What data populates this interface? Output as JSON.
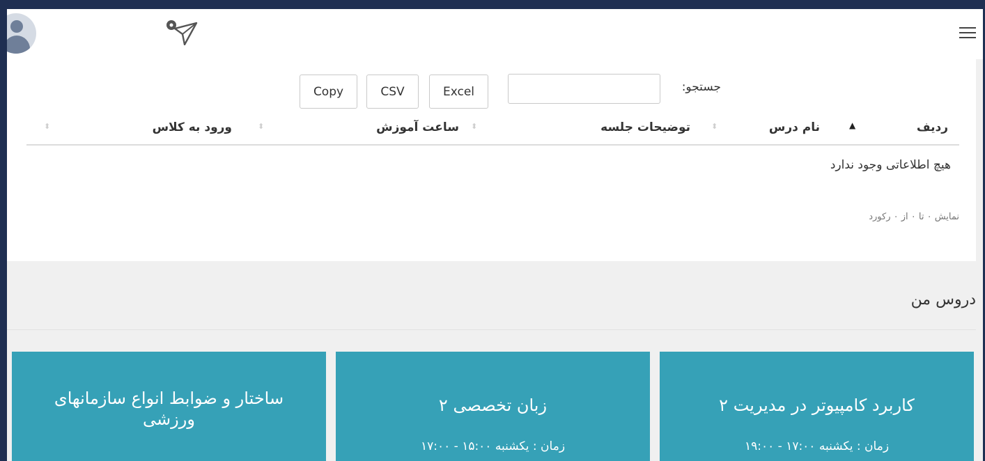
{
  "toolbar": {
    "search_label": "جستجو:",
    "search_value": "",
    "buttons": [
      "Excel",
      "CSV",
      "Copy"
    ]
  },
  "table": {
    "columns": [
      "ردیف",
      "نام درس",
      "توضیحات جلسه",
      "ساعت آموزش",
      "ورود به کلاس"
    ],
    "empty_message": "هیچ اطلاعاتی وجود ندارد",
    "info": "نمایش ۰ تا ۰ از ۰ رکورد"
  },
  "my_courses": {
    "title": "دروس من",
    "courses": [
      {
        "name": "کاربرد کامپیوتر در مدیریت ۲",
        "time": "زمان : یکشنبه ۱۷:۰۰ - ۱۹:۰۰"
      },
      {
        "name": "زبان تخصصی ۲",
        "time": "زمان : یکشنبه ۱۵:۰۰ - ۱۷:۰۰"
      },
      {
        "name": "ساختار و ضوابط انواع سازمانهای ورزشی",
        "time": ""
      }
    ]
  },
  "colors": {
    "frame": "#1f2f52",
    "course_card": "#36a1b7",
    "page_bg": "#f0f0f0"
  },
  "icons": [
    "hamburger-menu-icon",
    "user-avatar-icon",
    "send-paper-plane-icon",
    "sort-icon"
  ]
}
